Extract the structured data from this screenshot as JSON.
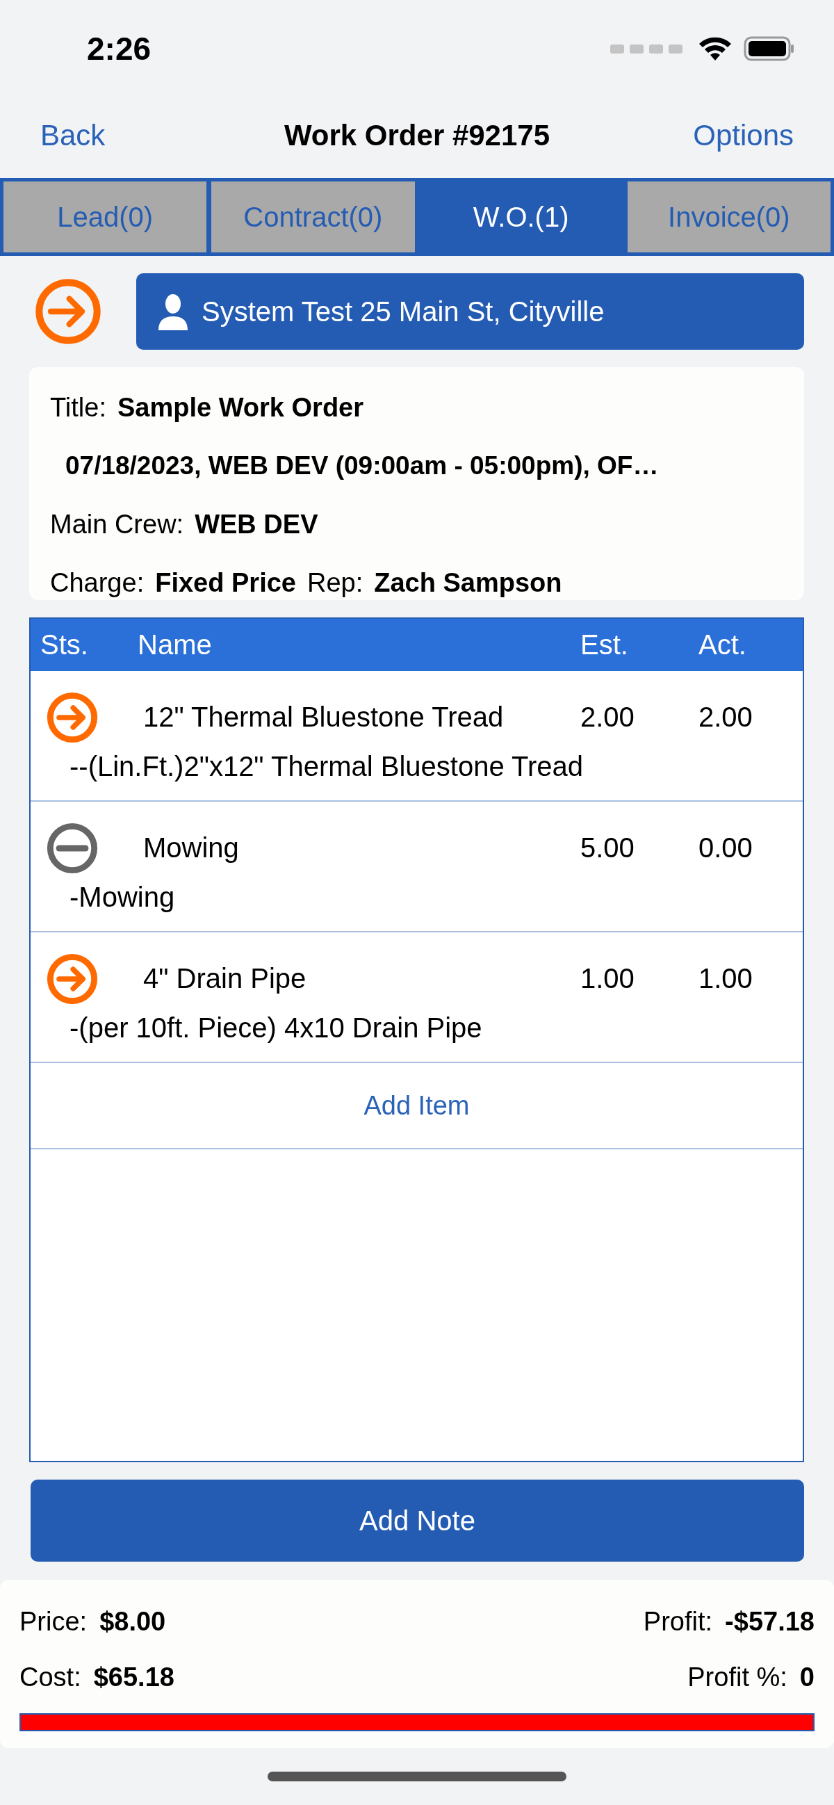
{
  "status_bar": {
    "time": "2:26"
  },
  "nav": {
    "back": "Back",
    "title": "Work Order #92175",
    "options": "Options"
  },
  "tabs": [
    {
      "label": "Lead(0)",
      "selected": false
    },
    {
      "label": "Contract(0)",
      "selected": false
    },
    {
      "label": "W.O.(1)",
      "selected": true
    },
    {
      "label": "Invoice(0)",
      "selected": false
    }
  ],
  "customer": {
    "label": "System Test 25 Main St, Cityville"
  },
  "details": {
    "title_label": "Title:",
    "title": "Sample Work Order",
    "schedule": "07/18/2023, WEB DEV (09:00am - 05:00pm), OF…",
    "crew_label": "Main Crew:",
    "crew": "WEB DEV",
    "charge_label": "Charge:",
    "charge": "Fixed Price",
    "rep_label": "Rep:",
    "rep": "Zach Sampson"
  },
  "table": {
    "columns": [
      "Sts.",
      "Name",
      "Est.",
      "Act."
    ],
    "rows": [
      {
        "kind": "active",
        "name": "12\" Thermal Bluestone Tread",
        "est": "2.00",
        "act": "2.00",
        "description": "--(Lin.Ft.)2\"x12\" Thermal Bluestone Tread"
      },
      {
        "kind": "stopped",
        "name": "Mowing",
        "est": "5.00",
        "act": "0.00",
        "description": "-Mowing"
      },
      {
        "kind": "active",
        "name": "4\" Drain Pipe",
        "est": "1.00",
        "act": "1.00",
        "description": "-(per 10ft. Piece) 4x10 Drain Pipe"
      }
    ],
    "add_item": "Add Item"
  },
  "add_note": "Add Note",
  "summary": {
    "price_label": "Price:",
    "price": "$8.00",
    "profit_label": "Profit:",
    "profit": "-$57.18",
    "cost_label": "Cost:",
    "cost": "$65.18",
    "profit_pct_label": "Profit %:",
    "profit_pct": "0",
    "bar": {
      "level": 1
    }
  }
}
